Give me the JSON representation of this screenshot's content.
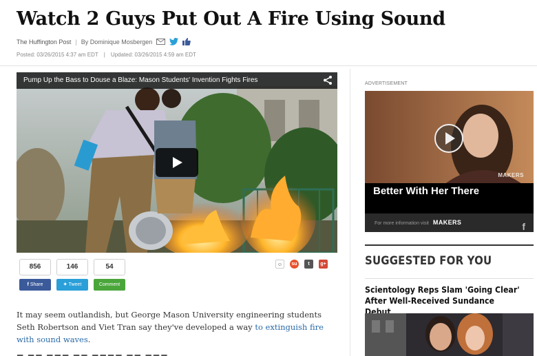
{
  "article": {
    "headline": "Watch 2 Guys Put Out A Fire Using Sound",
    "source": "The Huffington Post",
    "author": "By Dominique Mosbergen",
    "posted": "Posted: 03/26/2015 4:37 am EDT",
    "updated": "Updated: 03/26/2015 4:59 am EDT",
    "body": {
      "text_before_link": "It may seem outlandish, but George Mason University engineering students Seth Robertson and Viet Tran say they've developed a way ",
      "link_text": "to extinguish fire with sound waves",
      "text_after_link": "."
    }
  },
  "video": {
    "title": "Pump Up the Bass to Douse a Blaze: Mason Students' Invention Fights Fires",
    "share_icon": "share-icon",
    "play_icon": "play-icon"
  },
  "social": {
    "counts": [
      "856",
      "146",
      "54"
    ],
    "buttons": {
      "facebook": "Share",
      "twitter": "Tweet",
      "comment": "Comment"
    },
    "icons": [
      "reddit-icon",
      "stumbleupon-icon",
      "tumblr-icon",
      "google-plus-icon"
    ],
    "colors": {
      "facebook": "#3b5a9a",
      "twitter": "#2a9fd8",
      "comment": "#4aa63a"
    }
  },
  "sidebar": {
    "ad_label": "ADVERTISEMENT",
    "ad": {
      "caption": "Better With Her There",
      "footer_text": "For more information visit",
      "brand": "MAKERS",
      "watermark": "MAKERS"
    },
    "suggested_heading": "SUGGESTED FOR YOU",
    "suggested_item": {
      "title": "Scientology Reps Slam 'Going Clear' After Well-Received Sundance Debut"
    }
  }
}
